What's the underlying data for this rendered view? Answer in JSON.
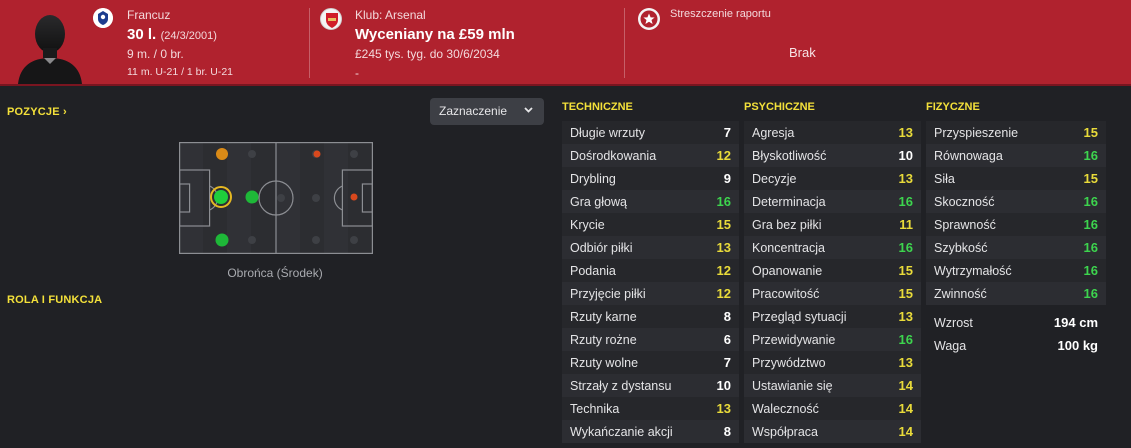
{
  "header": {
    "nationality": "Francuz",
    "age": "30 l.",
    "birth_date": "(24/3/2001)",
    "caps": "9 m. / 0 br.",
    "youth_caps": "11 m. U-21 / 1 br. U-21",
    "club": "Klub: Arsenal",
    "valuation": "Wyceniany na £59 mln",
    "contract": "£245 tys. tyg. do 30/6/2034",
    "dash": "-",
    "report_title": "Streszczenie raportu",
    "report_value": "Brak"
  },
  "positions": {
    "title": "POZYCJE",
    "chevron": "›",
    "dropdown_label": "Zaznaczenie",
    "position_label": "Obrońca (Środek)"
  },
  "role": {
    "title": "ROLA I FUNKCJA"
  },
  "colors": {
    "header_bg": "#b0222e",
    "accent_yellow": "#f4e13a",
    "value_green": "#3dd44e",
    "value_yellow": "#e9db3a",
    "value_white": "#ffffff"
  },
  "technical": {
    "title": "TECHNICZNE",
    "rows": [
      {
        "name": "Długie wrzuty",
        "value": "7"
      },
      {
        "name": "Dośrodkowania",
        "value": "12"
      },
      {
        "name": "Drybling",
        "value": "9"
      },
      {
        "name": "Gra głową",
        "value": "16"
      },
      {
        "name": "Krycie",
        "value": "15"
      },
      {
        "name": "Odbiór piłki",
        "value": "13"
      },
      {
        "name": "Podania",
        "value": "12"
      },
      {
        "name": "Przyjęcie piłki",
        "value": "12"
      },
      {
        "name": "Rzuty karne",
        "value": "8"
      },
      {
        "name": "Rzuty rożne",
        "value": "6"
      },
      {
        "name": "Rzuty wolne",
        "value": "7"
      },
      {
        "name": "Strzały z dystansu",
        "value": "10"
      },
      {
        "name": "Technika",
        "value": "13"
      },
      {
        "name": "Wykańczanie akcji",
        "value": "8"
      }
    ]
  },
  "mental": {
    "title": "PSYCHICZNE",
    "rows": [
      {
        "name": "Agresja",
        "value": "13"
      },
      {
        "name": "Błyskotliwość",
        "value": "10"
      },
      {
        "name": "Decyzje",
        "value": "13"
      },
      {
        "name": "Determinacja",
        "value": "16"
      },
      {
        "name": "Gra bez piłki",
        "value": "11"
      },
      {
        "name": "Koncentracja",
        "value": "16"
      },
      {
        "name": "Opanowanie",
        "value": "15"
      },
      {
        "name": "Pracowitość",
        "value": "15"
      },
      {
        "name": "Przegląd sytuacji",
        "value": "13"
      },
      {
        "name": "Przewidywanie",
        "value": "16"
      },
      {
        "name": "Przywództwo",
        "value": "13"
      },
      {
        "name": "Ustawianie się",
        "value": "14"
      },
      {
        "name": "Waleczność",
        "value": "14"
      },
      {
        "name": "Współpraca",
        "value": "14"
      }
    ]
  },
  "physical": {
    "title": "FIZYCZNE",
    "rows": [
      {
        "name": "Przyspieszenie",
        "value": "15"
      },
      {
        "name": "Równowaga",
        "value": "16"
      },
      {
        "name": "Siła",
        "value": "15"
      },
      {
        "name": "Skoczność",
        "value": "16"
      },
      {
        "name": "Sprawność",
        "value": "16"
      },
      {
        "name": "Szybkość",
        "value": "16"
      },
      {
        "name": "Wytrzymałość",
        "value": "16"
      },
      {
        "name": "Zwinność",
        "value": "16"
      }
    ],
    "extra": [
      {
        "name": "Wzrost",
        "value": "194 cm"
      },
      {
        "name": "Waga",
        "value": "100 kg"
      }
    ]
  }
}
